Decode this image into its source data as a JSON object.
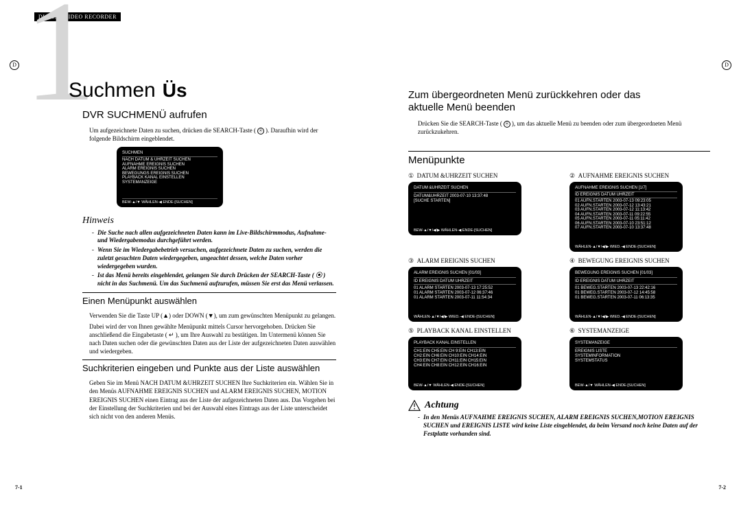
{
  "header": "DIGITAL VIDEO RECORDER",
  "side_badge": "D",
  "chapter_title_a": "Suchmen",
  "chapter_title_b": "Üs",
  "left": {
    "h2_1": "DVR SUCHMENÜ aufrufen",
    "p1": "Um aufgezeichnete Daten zu suchen, drücken die SEARCH-Taste (",
    "p1b": "). Daraufhin wird der folgende Bildschirm eingeblendet.",
    "screen1": {
      "title": "SUCHMEN",
      "lines": [
        "NACH DATUM & UHRZEIT SUCHEN",
        "AUFNAHME EREIGNIS SUCHEN",
        "ALARM EREIGNIS SUCHEN",
        "BEWEGUNGS EREIGNIS SUCHEN",
        "PLAYBACK KANAL EINSTELLEN",
        "SYSTEMANZEIGE"
      ],
      "footer": "BEW-▲/▼   WÄHLEN-◀   ENDE-[SUCHEN]"
    },
    "hinweis_title": "Hinweis",
    "hinweis_items": [
      "Die Suche nach allen aufgezeichneten Daten kann im Live-Bildschirmmodus, Aufnahme- und Wiedergabemodus durchgeführt werden.",
      "Wenn Sie im Wiedergabebetrieb versuchen, aufgezeichnete Daten zu suchen, werden die zuletzt gesuchten Daten wiedergegeben, ungeachtet dessen, welche Daten vorher wiedergegeben wurden.",
      "Ist das Menü bereits eingeblendet, gelangen Sie durch Drücken der SEARCH-Taste ( ⦿ ) nicht in das Suchmenü. Um das Suchmenü aufzurufen, müssen Sie erst das Menü verlassen."
    ],
    "h3_2": "Einen Menüpunkt auswählen",
    "p2a": "Verwenden Sie die Taste UP (▲) oder DOWN (▼), um zum gewünschten Menüpunkt zu gelangen.",
    "p2b": "Dabei wird der von Ihnen gewählte Menüpunkt mittels Cursor hervorgehoben. Drücken Sie anschließend die Eingabetaste ( ↵ ), um Ihre Auswahl zu bestätigen. Im Untermenü können Sie nach Daten suchen oder die gewünschten Daten aus der Liste der aufgezeichneten Daten auswählen und wiedergeben.",
    "h3_3": "Suchkriterien eingeben und Punkte aus der Liste auswählen",
    "p3": "Geben Sie im Menü NACH DATUM &UHRZEIT SUCHEN Ihre Suchkriterien ein. Wählen Sie in den Menüs AUFNAHME EREIGNIS SUCHEN und ALARM EREIGNIS SUCHEN, MOTION EREIGNIS SUCHEN einen Eintrag aus der Liste der aufgezeichneten Daten aus. Das Vorgehen bei der Einstellung der Suchkriterien und bei der Auswahl eines Eintrags aus der Liste unterscheidet sich nicht von den anderen Menüs.",
    "pagenum": "7-1"
  },
  "right": {
    "h2_1a": "Zum übergeordneten Menü zurückkehren oder das",
    "h2_1b": "aktuelle Menü beenden",
    "p1a": "Drücken Sie die SEARCH-Taste (",
    "p1b": "), um das aktuelle Menü zu beenden oder zum übergeordneten Menü zurückzukehren.",
    "h2_2": "Menüpunkte",
    "menu": [
      {
        "num": "①",
        "label": "DATUM &UHRZEIT SUCHEN",
        "screen": {
          "title": "DATUM &UHRZEIT SUCHEN",
          "lines": [
            "DATUM&UHRZEIT  2003-07-10  13:37:48",
            "[SUCHE STARTEN]"
          ],
          "footer": "BEW-▲/▼/◀/▶  WÄHLEN-◀  ENDE-[SUCHEN]"
        }
      },
      {
        "num": "②",
        "label": "AUFNAHME EREIGNIS SUCHEN",
        "screen": {
          "title": "AUFNAHME EREIGNIS SUCHEN        [1/7]",
          "lines": [
            "ID  EREIGNIS          DATUM     UHRZEIT",
            "01 AUFN.STARTEN 2003-07-13 09:23:05",
            "02 AUFN.STARTEN 2003-07-12 13:43:21",
            "03 AUFN.STARTEN 2003-07-12 11:13:42",
            "04 AUFN.STARTEN 2003-07-11 09:22:55",
            "05 AUFN.STARTEN 2003-07-11 05:11:42",
            "06 AUFN.STARTEN 2003-07-10 23:51:12",
            "07 AUFN.STARTEN 2003-07-10 13:37:48"
          ],
          "footer": "WÄHLEN-▲/▼/◀/▶  WIED.-◀  ENDE-[SUCHEN]"
        }
      },
      {
        "num": "③",
        "label": "ALARM EREIGNIS SUCHEN",
        "screen": {
          "title": "ALARM EREIGNIS SUCHEN        [01/03]",
          "lines": [
            "ID  EREIGNIS              DATUM     UHRZEIT",
            "01 ALARM STARTEN 2003-07-13 17:25:52",
            "01 ALARM STARTEN 2003-07-12 06:37:46",
            "01 ALARM STARTEN 2003-07-11 11:54:34"
          ],
          "footer": "WÄHLEN-▲/▼/◀/▶  WIED.-◀  ENDE-[SUCHEN]"
        }
      },
      {
        "num": "④",
        "label": "BEWEGUNG EREIGNIS SUCHEN",
        "screen": {
          "title": "BEWEGUNG EREIGNIS SUCHEN    [01/03]",
          "lines": [
            "ID  EREIGNIS              DATUM     UHRZEIT",
            "01 BEWEG.STARTEN 2003-07-13 22:42:16",
            "01 BEWEG.STARTEN 2003-07-12 14:45:58",
            "01 BEWEG.STARTEN 2003-07-11 06:13:35"
          ],
          "footer": "WÄHLEN-▲/▼/◀/▶  WIED.-◀  ENDE-[SUCHEN]"
        }
      },
      {
        "num": "⑤",
        "label": "PLAYBACK KANAL EINSTELLEN",
        "screen": {
          "title": "PLAYBACK KANAL EINSTELLEN",
          "lines": [
            "CH1:EIN   CH5:EIN   CH  9:EIN   CH13:EIN",
            "CH2:EIN   CH6:EIN   CH10:EIN   CH14:EIN",
            "CH3:EIN   CH7:EIN   CH11:EIN   CH15:EIN",
            "CH4:EIN   CH8:EIN   CH12:EIN   CH16:EIN"
          ],
          "footer": "BEW-▲/▼   WÄHLEN-◀   ENDE-[SUCHEN]"
        }
      },
      {
        "num": "⑥",
        "label": "SYSTEMANZEIGE",
        "screen": {
          "title": "SYSTEMANZEIGE",
          "lines": [
            "EREIGNIS LISTE",
            "SYSTEMINFORMATION",
            "SYSTEMSTATUS"
          ],
          "footer": "BEW-▲/▼   WÄHLEN-◀   ENDE-[SUCHEN]"
        }
      }
    ],
    "achtung_title": "Achtung",
    "achtung_items": [
      "In den Menüs AUFNAHME EREIGNIS SUCHEN, ALARM EREIGNIS SUCHEN,MOTION EREIGNIS SUCHEN und EREIGNIS LISTE wird keine Liste eingeblendet, da beim Versand noch keine Daten auf der Festplatte vorhanden sind."
    ],
    "pagenum": "7-2"
  }
}
